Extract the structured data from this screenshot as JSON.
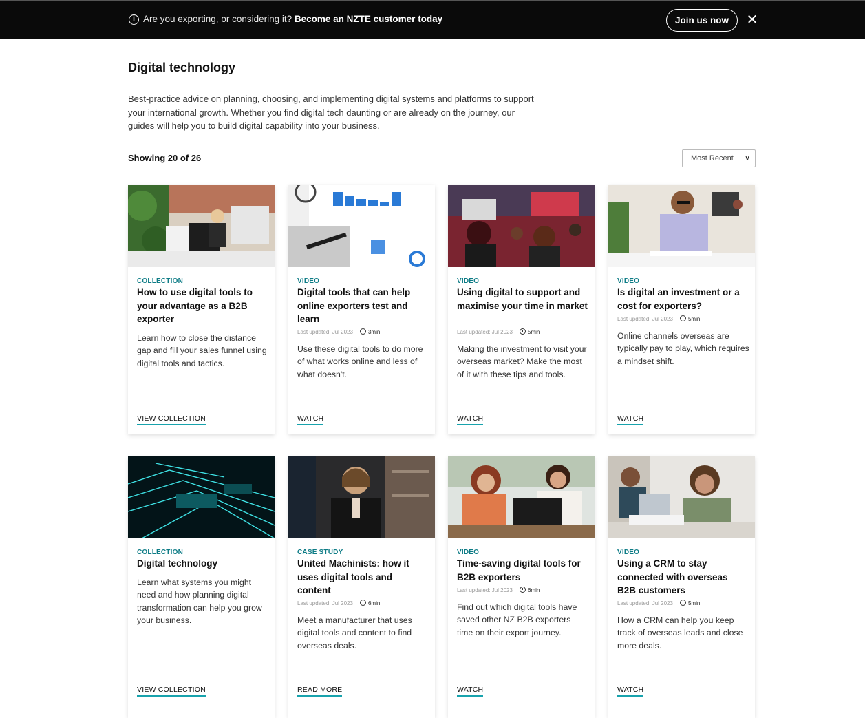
{
  "banner": {
    "info_icon": "info-icon",
    "message": "Are you exporting, or considering it?",
    "message_bold": "Become an NZTE customer today",
    "join_label": "Join us now",
    "close_icon": "close-icon"
  },
  "page": {
    "title": "Digital technology",
    "intro": "Best-practice advice on planning, choosing, and implementing digital systems and platforms to support your international growth. Whether you find digital tech daunting or are already on the journey, our guides will help you to build digital capability into your business.",
    "showing": "Showing 20 of 26",
    "sort_value": "Most Recent"
  },
  "accent_color": "#0e7c86",
  "cards": [
    {
      "type": "COLLECTION",
      "title": "How to use digital tools to your advantage as a B2B exporter",
      "updated": "",
      "duration": "",
      "description": "Learn how to close the distance gap and fill your sales funnel using digital tools and tactics.",
      "cta": "VIEW COLLECTION"
    },
    {
      "type": "VIDEO",
      "title": "Digital tools that can help online exporters test and learn",
      "updated": "Last updated: Jul 2023",
      "duration": "3min",
      "description": "Use these digital tools to do more of what works online and less of what doesn't.",
      "cta": "WATCH"
    },
    {
      "type": "VIDEO",
      "title": "Using digital to support and maximise your time in market",
      "updated": "Last updated: Jul 2023",
      "duration": "5min",
      "description": "Making the investment to visit your overseas market? Make the most of it with these tips and tools.",
      "cta": "WATCH"
    },
    {
      "type": "VIDEO",
      "title": "Is digital an investment or a cost for exporters?",
      "updated": "Last updated: Jul 2023",
      "duration": "5min",
      "description": "Online channels overseas are typically pay to play, which requires a mindset shift.",
      "cta": "WATCH"
    },
    {
      "type": "COLLECTION",
      "title": "Digital technology",
      "updated": "",
      "duration": "",
      "description": "Learn what systems you might need and how planning digital transformation can help you grow your business.",
      "cta": "VIEW COLLECTION"
    },
    {
      "type": "CASE STUDY",
      "title": "United Machinists: how it uses digital tools and content",
      "updated": "Last updated: Jul 2023",
      "duration": "6min",
      "description": "Meet a manufacturer that uses digital tools and content to find overseas deals.",
      "cta": "READ MORE"
    },
    {
      "type": "VIDEO",
      "title": "Time-saving digital tools for B2B exporters",
      "updated": "Last updated: Jul 2023",
      "duration": "6min",
      "description": "Find out which digital tools have saved other NZ B2B exporters time on their export journey.",
      "cta": "WATCH"
    },
    {
      "type": "VIDEO",
      "title": "Using a CRM to stay connected with overseas B2B customers",
      "updated": "Last updated: Jul 2023",
      "duration": "5min",
      "description": "How a CRM can help you keep track of overseas leads and close more deals.",
      "cta": "WATCH"
    }
  ]
}
